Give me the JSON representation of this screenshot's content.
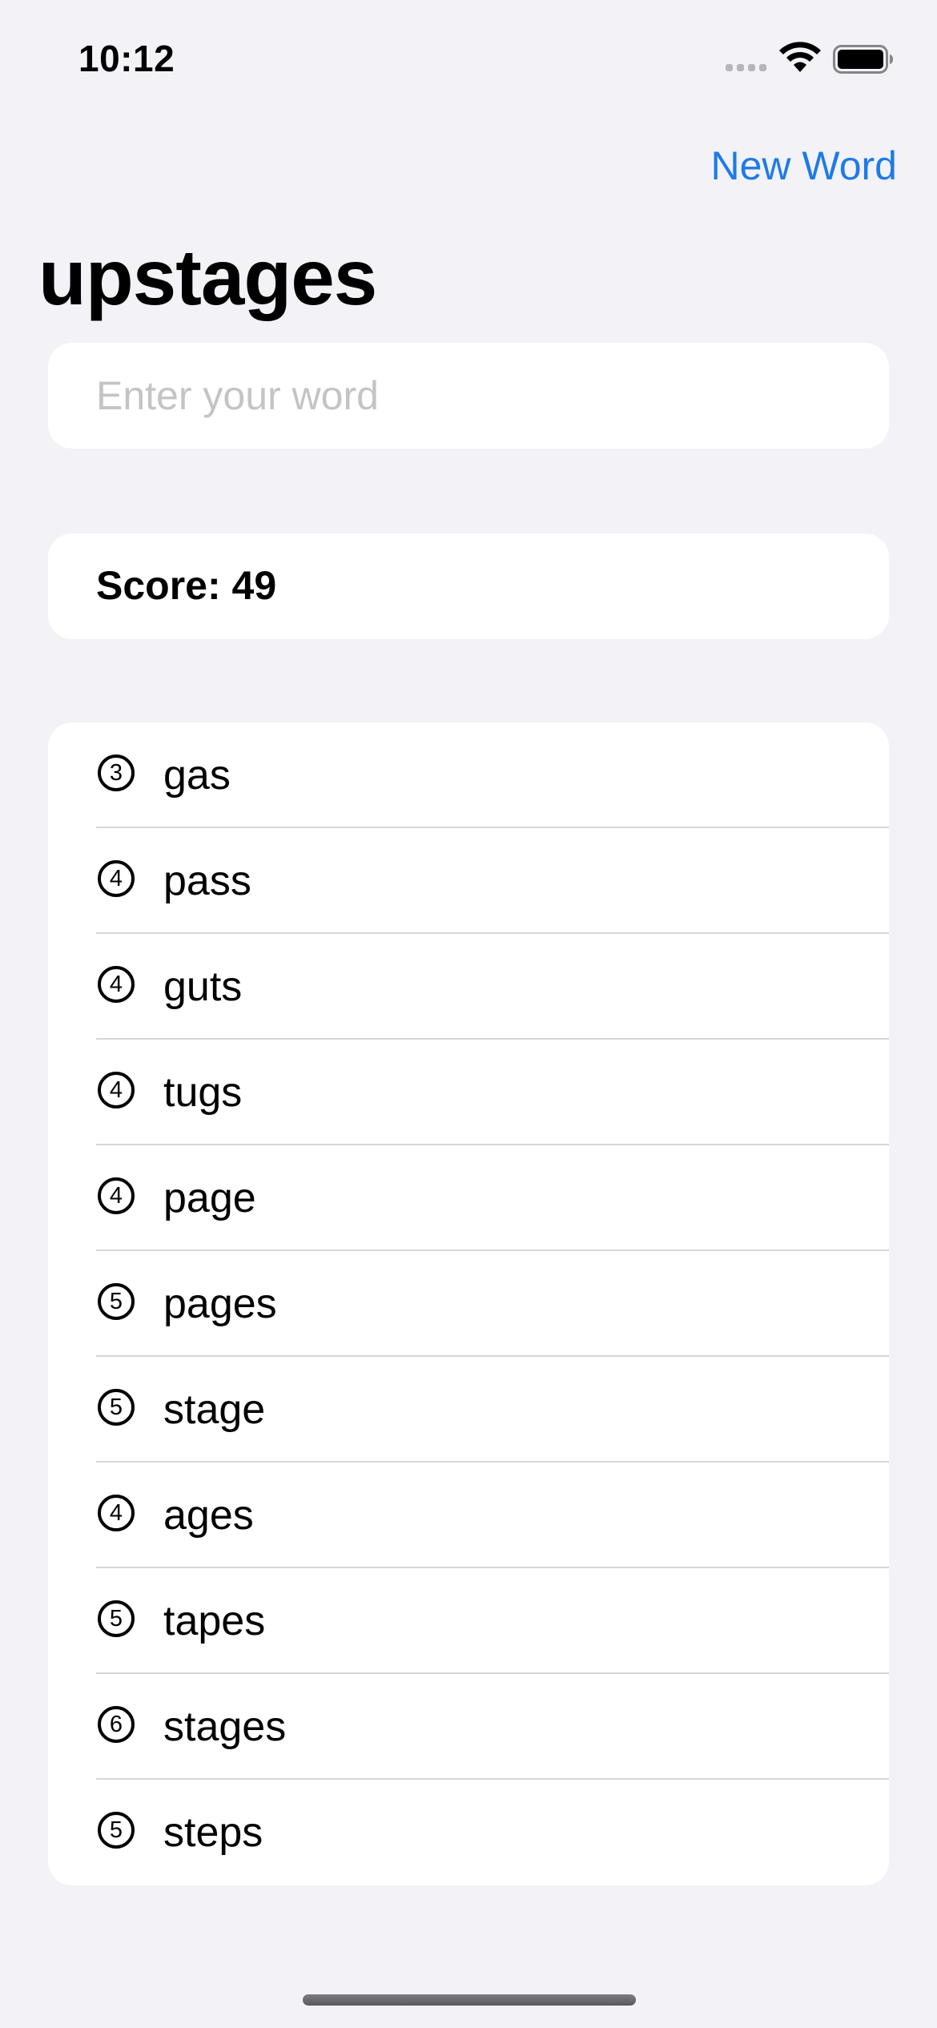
{
  "status_bar": {
    "time": "10:12"
  },
  "nav": {
    "new_word_label": "New Word"
  },
  "title": "upstages",
  "input": {
    "placeholder": "Enter your word",
    "value": ""
  },
  "score": {
    "text": "Score: 49"
  },
  "words": [
    {
      "count": "3",
      "word": "gas"
    },
    {
      "count": "4",
      "word": "pass"
    },
    {
      "count": "4",
      "word": "guts"
    },
    {
      "count": "4",
      "word": "tugs"
    },
    {
      "count": "4",
      "word": "page"
    },
    {
      "count": "5",
      "word": "pages"
    },
    {
      "count": "5",
      "word": "stage"
    },
    {
      "count": "4",
      "word": "ages"
    },
    {
      "count": "5",
      "word": "tapes"
    },
    {
      "count": "6",
      "word": "stages"
    },
    {
      "count": "5",
      "word": "steps"
    }
  ],
  "colors": {
    "accent": "#1f7ae6",
    "background": "#f2f2f7",
    "card": "#ffffff"
  }
}
